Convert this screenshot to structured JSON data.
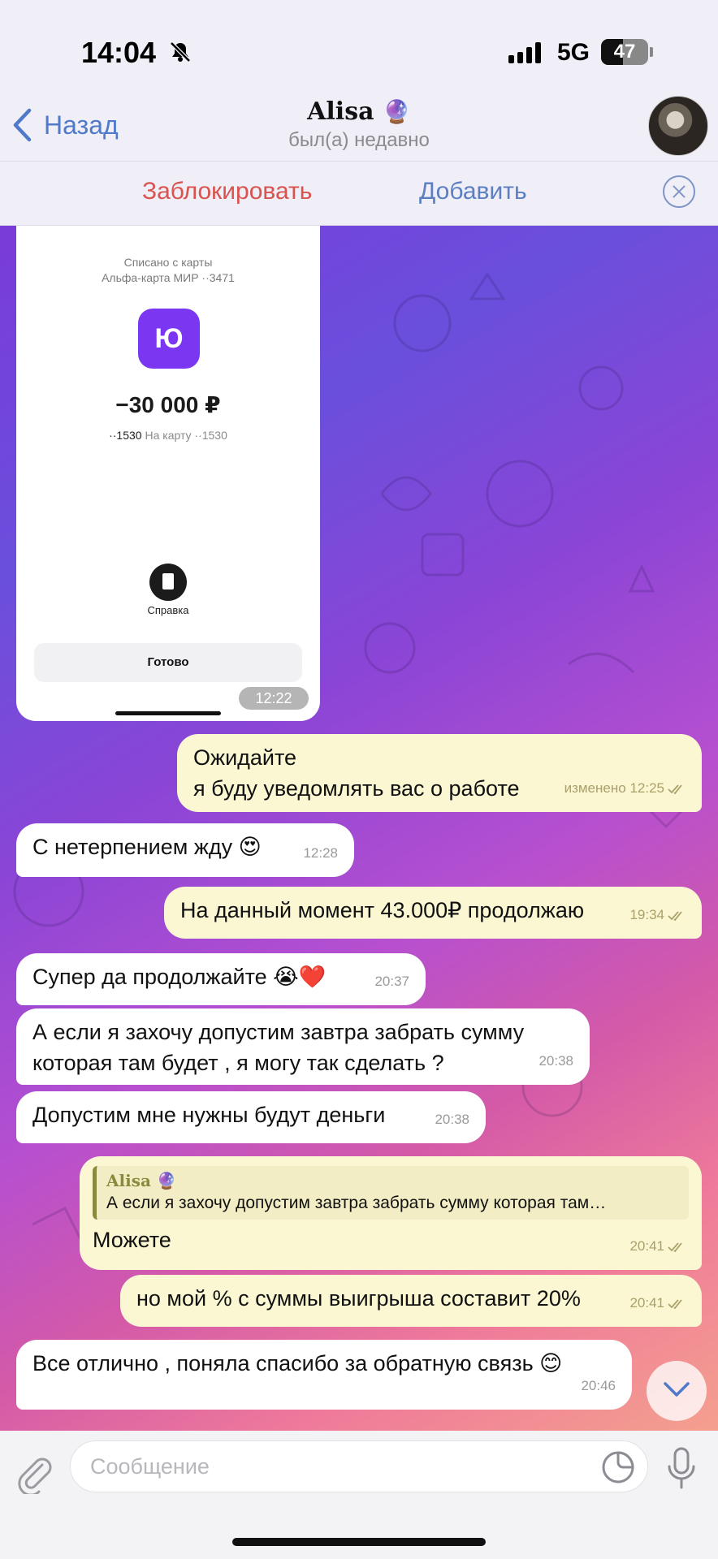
{
  "status_bar": {
    "time": "14:04",
    "network": "5G",
    "battery": "47",
    "battery_level": 0.47
  },
  "header": {
    "back_label": "Назад",
    "contact_name": "Alisa",
    "contact_emoji": "🔮",
    "contact_status": "был(а) недавно"
  },
  "action_bar": {
    "block_label": "Заблокировать",
    "add_label": "Добавить"
  },
  "image_message": {
    "charged_from": "Списано с карты",
    "card_name": "Альфа-карта МИР ··3471",
    "logo_text": "Ю",
    "amount": "−30 000 ₽",
    "from_card": "··1530",
    "to_card": "На карту ··1530",
    "reference_label": "Справка",
    "done_label": "Готово",
    "time": "12:22"
  },
  "messages": [
    {
      "dir": "out",
      "lines": [
        "Ожидайте",
        "я буду уведомлять вас о работе"
      ],
      "meta": "изменено 12:25"
    },
    {
      "dir": "in",
      "text": "С нетерпением жду 😍",
      "meta": "12:28"
    },
    {
      "dir": "out",
      "text": "На данный момент 43.000₽ продолжаю",
      "meta": "19:34"
    },
    {
      "dir": "in",
      "text": "Супер да продолжайте 😭❤️",
      "meta": "20:37"
    },
    {
      "dir": "in",
      "lines": [
        "А если я захочу допустим завтра забрать сумму",
        "которая там будет , я могу так сделать ?"
      ],
      "meta": "20:38"
    },
    {
      "dir": "in",
      "text": "Допустим мне нужны будут деньги",
      "meta": "20:38"
    },
    {
      "dir": "out",
      "reply_name": "Alisa 🔮",
      "reply_text": "А если я захочу допустим завтра забрать сумму которая там…",
      "text": "Можете",
      "meta": "20:41"
    },
    {
      "dir": "out",
      "text": "но мой % с суммы выигрыша составит 20%",
      "meta": "20:41"
    },
    {
      "dir": "in",
      "text": "Все отлично , поняла спасибо за обратную связь 😊",
      "meta": "20:46"
    }
  ],
  "input": {
    "placeholder": "Сообщение",
    "value": ""
  },
  "colors": {
    "accent": "#4f79c9",
    "block": "#d9534f",
    "outgoing_bubble": "#fbf7d2",
    "incoming_bubble": "#ffffff"
  },
  "icons": [
    "bell-slash-icon",
    "signal-icon",
    "battery-icon",
    "chevron-left-icon",
    "close-icon",
    "document-icon",
    "double-check-icon",
    "chevron-down-icon",
    "paperclip-icon",
    "sticker-icon",
    "microphone-icon"
  ]
}
